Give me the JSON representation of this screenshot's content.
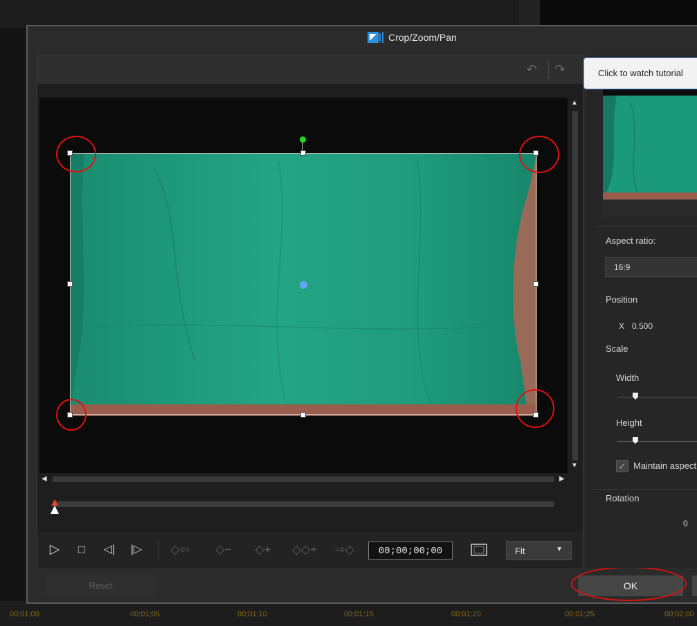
{
  "dialog": {
    "title": "Crop/Zoom/Pan"
  },
  "toolbar": {
    "undo_glyph": "↶",
    "redo_glyph": "↷"
  },
  "transport": {
    "play": "▷",
    "stop": "□",
    "prev_frame": "◁|",
    "next_frame": "|▷",
    "prev_keyframe": "◇⇦",
    "remove_keyframe": "◇−",
    "add_keyframe": "◇+",
    "duplicate_keyframe": "◇◇+",
    "next_keyframe": "⇨◇",
    "timecode": "00;00;00;00",
    "fit_label": "Fit",
    "fit_arrow": "▼"
  },
  "buttons": {
    "reset": "Reset",
    "ok": "OK"
  },
  "right_panel": {
    "tooltip": "Click to watch tutorial",
    "aspect_ratio_label": "Aspect ratio:",
    "aspect_ratio_value": "16:9",
    "position_label": "Position",
    "x_label": "X",
    "x_value": "0.500",
    "scale_label": "Scale",
    "width_label": "Width",
    "height_label": "Height",
    "maintain_label": "Maintain aspect ratio",
    "check_glyph": "✓",
    "rotation_label": "Rotation",
    "rotation_value": "0"
  },
  "timeline": {
    "labels": [
      "00;01;00",
      "00;01;05",
      "00;01;10",
      "00;01;15",
      "00;01;20",
      "00;01;25",
      "00;02;00"
    ]
  },
  "colors": {
    "annotation_red": "#e01010",
    "rotate_handle": "#22d822",
    "center_dot": "#6fa4ff",
    "green_screen": "#1f9e7e",
    "tooltip_border": "#5a93d8"
  },
  "icons": {
    "title_icon": "video-crop-icon",
    "safe_zone": "safe-zone-icon",
    "scroll_up": "▲",
    "scroll_down": "▼",
    "scroll_left": "◀",
    "scroll_right": "▶"
  }
}
